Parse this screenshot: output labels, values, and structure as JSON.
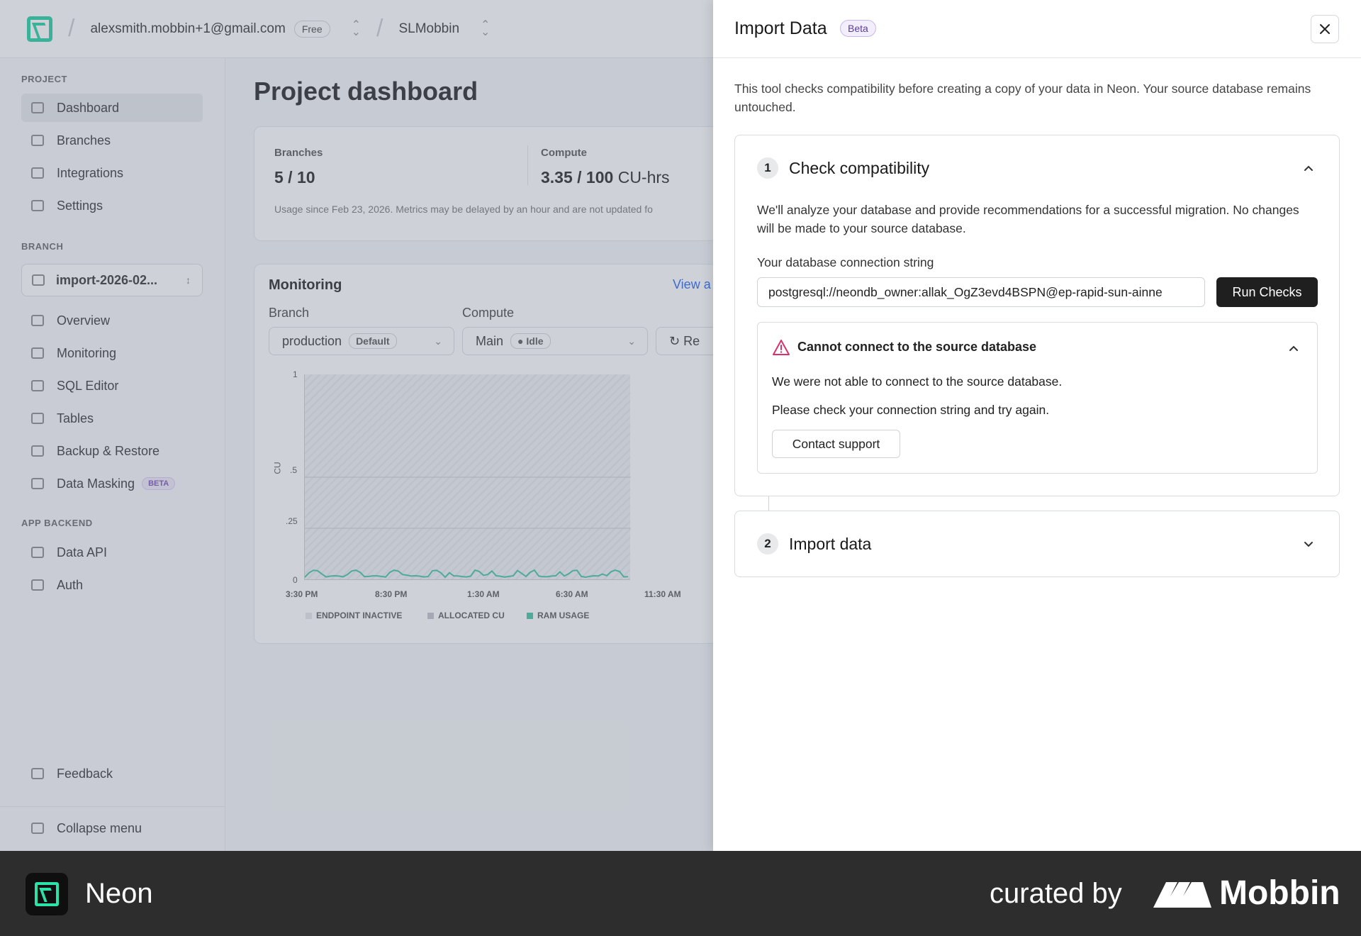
{
  "topbar": {
    "account_email": "alexsmith.mobbin+1@gmail.com",
    "plan_badge": "Free",
    "project_name": "SLMobbin"
  },
  "sidebar": {
    "sections": {
      "project": "PROJECT",
      "branch": "BRANCH",
      "app_backend": "APP BACKEND"
    },
    "project_items": [
      "Dashboard",
      "Branches",
      "Integrations",
      "Settings"
    ],
    "branch_selector": "import-2026-02...",
    "branch_items": [
      "Overview",
      "Monitoring",
      "SQL Editor",
      "Tables",
      "Backup & Restore",
      "Data Masking"
    ],
    "data_masking_badge": "BETA",
    "backend_items": [
      "Data API",
      "Auth"
    ],
    "feedback": "Feedback",
    "collapse": "Collapse menu"
  },
  "dashboard": {
    "title": "Project dashboard",
    "branches_label": "Branches",
    "branches_value": "5 / 10",
    "compute_label": "Compute",
    "compute_value": "3.35 / 100",
    "compute_unit": "CU-hrs",
    "usage_note": "Usage since Feb 23, 2026. Metrics may be delayed by an hour and are not updated fo",
    "monitoring": {
      "title": "Monitoring",
      "view_link": "View a",
      "branch_label": "Branch",
      "branch_value": "production",
      "branch_tag": "Default",
      "compute_label": "Compute",
      "compute_value": "Main",
      "compute_tag": "Idle",
      "refresh_label": "Re",
      "chart_data": {
        "type": "area",
        "yticks": [
          "1",
          ".5",
          ".25",
          "0"
        ],
        "ylabel": "CU",
        "xticks": [
          "3:30 PM",
          "8:30 PM",
          "1:30 AM",
          "6:30 AM",
          "11:30 AM"
        ],
        "legend": [
          "ENDPOINT INACTIVE",
          "ALLOCATED CU",
          "RAM USAGE"
        ],
        "colors": {
          "endpoint_inactive": "#e4e6e9",
          "allocated_cu": "#bfc3c8",
          "ram_usage": "#3fc6a0"
        }
      }
    }
  },
  "drawer": {
    "title": "Import Data",
    "badge": "Beta",
    "intro": "This tool checks compatibility before creating a copy of your data in Neon. Your source database remains untouched.",
    "step1": {
      "number": "1",
      "title": "Check compatibility",
      "description": "We'll analyze your database and provide recommendations for a successful migration. No changes will be made to your source database.",
      "field_label": "Your database connection string",
      "connection_string": "postgresql://neondb_owner:allak_OgZ3evd4BSPN@ep-rapid-sun-ainne",
      "run_button": "Run Checks",
      "alert": {
        "title": "Cannot connect to the source database",
        "line1": "We were not able to connect to the source database.",
        "line2": "Please check your connection string and try again.",
        "support_button": "Contact support"
      }
    },
    "step2": {
      "number": "2",
      "title": "Import data"
    }
  },
  "footer": {
    "brand": "Neon",
    "curated_by": "curated by",
    "mobbin": "Mobbin"
  },
  "colors": {
    "neon_accent": "#1fd1a0",
    "primary_button": "#1f1f1f",
    "alert_icon": "#d6336c",
    "beta_badge_text": "#5b3d99",
    "link": "#2563eb"
  }
}
